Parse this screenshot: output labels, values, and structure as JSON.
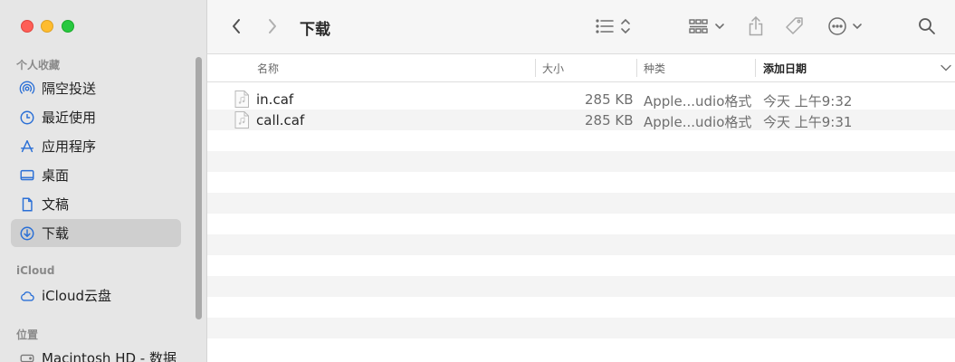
{
  "window": {
    "title": "下载"
  },
  "sidebar": {
    "sections": [
      {
        "title": "个人收藏",
        "items": [
          {
            "label": "隔空投送",
            "icon": "airdrop-icon",
            "selected": false
          },
          {
            "label": "最近使用",
            "icon": "clock-icon",
            "selected": false
          },
          {
            "label": "应用程序",
            "icon": "applications-icon",
            "selected": false
          },
          {
            "label": "桌面",
            "icon": "desktop-icon",
            "selected": false
          },
          {
            "label": "文稿",
            "icon": "document-icon",
            "selected": false
          },
          {
            "label": "下载",
            "icon": "download-icon",
            "selected": true
          }
        ]
      },
      {
        "title": "iCloud",
        "items": [
          {
            "label": "iCloud云盘",
            "icon": "cloud-icon",
            "selected": false
          }
        ]
      },
      {
        "title": "位置",
        "items": [
          {
            "label": "Macintosh HD - 数据",
            "icon": "disk-icon",
            "selected": false
          }
        ]
      }
    ]
  },
  "columns": {
    "name": "名称",
    "size": "大小",
    "kind": "种类",
    "date_added": "添加日期"
  },
  "files": [
    {
      "name": "in.caf",
      "size": "285 KB",
      "kind": "Apple...udio格式",
      "date_added": "今天 上午9:32"
    },
    {
      "name": "call.caf",
      "size": "285 KB",
      "kind": "Apple...udio格式",
      "date_added": "今天 上午9:31"
    }
  ],
  "colors": {
    "sidebar_bg": "#e6e6e6",
    "selection": "#cfcfcf",
    "accent_icon": "#2a6fd6",
    "row_alt": "#f4f4f4"
  }
}
